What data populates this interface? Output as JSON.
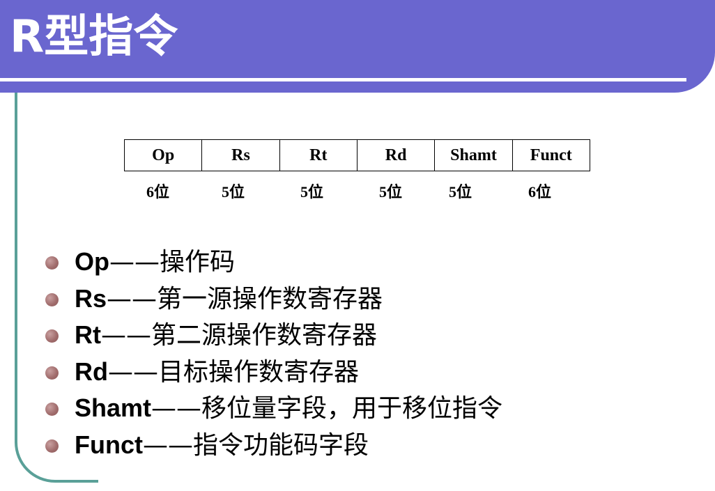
{
  "slide": {
    "title": "R型指令"
  },
  "format": {
    "fields": [
      "Op",
      "Rs",
      "Rt",
      "Rd",
      "Shamt",
      "Funct"
    ],
    "bits": [
      "6位",
      "5位",
      "5位",
      "5位",
      "5位",
      "6位"
    ]
  },
  "bullets": [
    {
      "term": "Op",
      "desc": "——操作码"
    },
    {
      "term": "Rs",
      "desc": "——第一源操作数寄存器"
    },
    {
      "term": "Rt",
      "desc": "——第二源操作数寄存器"
    },
    {
      "term": "Rd",
      "desc": "——目标操作数寄存器"
    },
    {
      "term": "Shamt",
      "desc": "——移位量字段，用于移位指令"
    },
    {
      "term": "Funct",
      "desc": "——指令功能码字段"
    }
  ],
  "colors": {
    "title_band": "#6a66cf",
    "frame": "#5aa098",
    "bullet": "#a26e6e"
  }
}
